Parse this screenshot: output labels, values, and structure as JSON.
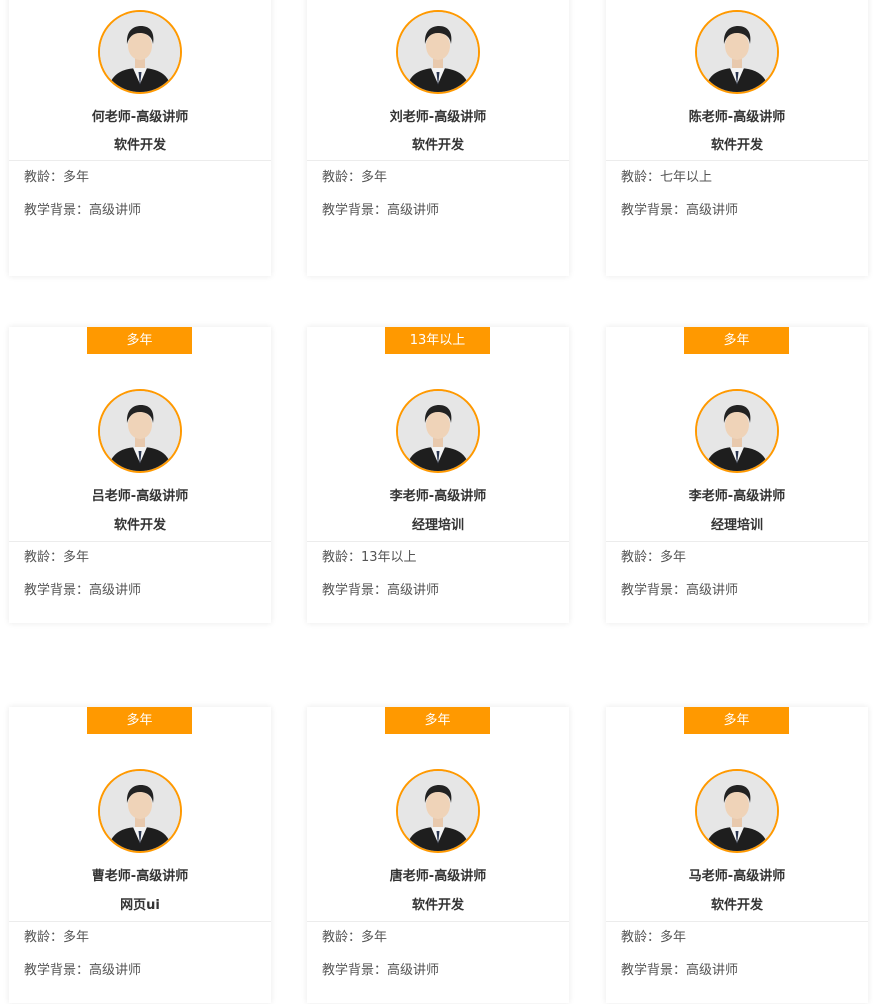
{
  "labels": {
    "age_prefix": "教龄：",
    "background_prefix": "教学背景："
  },
  "accent_color": "#ff9900",
  "teachers": [
    {
      "badge": "",
      "name": "何老师-高级讲师",
      "subject": "软件开发",
      "age": "多年",
      "background": "高级讲师"
    },
    {
      "badge": "",
      "name": "刘老师-高级讲师",
      "subject": "软件开发",
      "age": "多年",
      "background": "高级讲师"
    },
    {
      "badge": "",
      "name": "陈老师-高级讲师",
      "subject": "软件开发",
      "age": "七年以上",
      "background": "高级讲师"
    },
    {
      "badge": "多年",
      "name": "吕老师-高级讲师",
      "subject": "软件开发",
      "age": "多年",
      "background": "高级讲师"
    },
    {
      "badge": "13年以上",
      "name": "李老师-高级讲师",
      "subject": "经理培训",
      "age": "13年以上",
      "background": "高级讲师"
    },
    {
      "badge": "多年",
      "name": "李老师-高级讲师",
      "subject": "经理培训",
      "age": "多年",
      "background": "高级讲师"
    },
    {
      "badge": "多年",
      "name": "曹老师-高级讲师",
      "subject": "网页ui",
      "age": "多年",
      "background": "高级讲师"
    },
    {
      "badge": "多年",
      "name": "唐老师-高级讲师",
      "subject": "软件开发",
      "age": "多年",
      "background": "高级讲师"
    },
    {
      "badge": "多年",
      "name": "马老师-高级讲师",
      "subject": "软件开发",
      "age": "多年",
      "background": "高级讲师"
    }
  ]
}
